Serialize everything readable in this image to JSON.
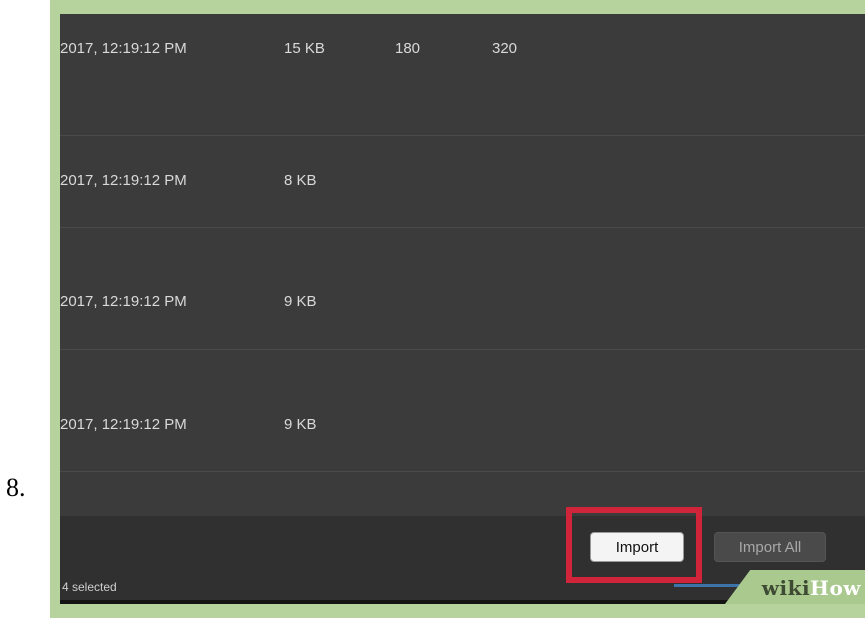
{
  "step_number": "8.",
  "rows": [
    {
      "date": "2017, 12:19:12 PM",
      "size": "15 KB",
      "col3": "180",
      "col4": "320"
    },
    {
      "date": "2017, 12:19:12 PM",
      "size": "8 KB",
      "col3": "",
      "col4": ""
    },
    {
      "date": "2017, 12:19:12 PM",
      "size": "9 KB",
      "col3": "",
      "col4": ""
    },
    {
      "date": "2017, 12:19:12 PM",
      "size": "9 KB",
      "col3": "",
      "col4": ""
    }
  ],
  "footer": {
    "import_label": "Import",
    "import_all_label": "Import All",
    "selected_status": "4 selected"
  },
  "watermark": {
    "part1": "wiki",
    "part2": "How"
  },
  "colors": {
    "frame": "#b7d39d",
    "window_background": "#3b3b3b",
    "highlight": "#d0243a"
  }
}
